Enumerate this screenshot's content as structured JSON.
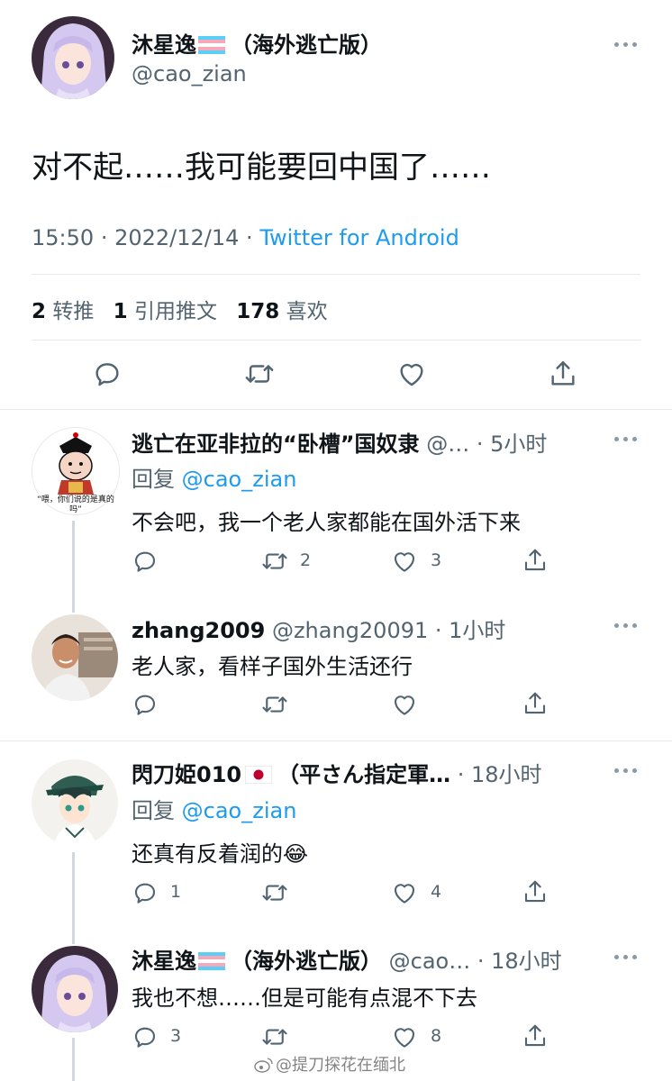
{
  "main_tweet": {
    "display_name": "沐星逸",
    "name_suffix": "（海外逃亡版）",
    "handle": "@cao_zian",
    "text": "对不起……我可能要回中国了……",
    "time": "15:50",
    "date": "2022/12/14",
    "source": "Twitter for Android",
    "retweets_count": "2",
    "retweets_label": "转推",
    "quotes_count": "1",
    "quotes_label": "引用推文",
    "likes_count": "178",
    "likes_label": "喜欢"
  },
  "replies": [
    {
      "display_name": "逃亡在亚非拉的“卧槽”国奴隶",
      "handle_trunc": "@…",
      "time": "5小时",
      "reply_prefix": "回复",
      "reply_to": "@cao_zian",
      "text": "不会吧，我一个老人家都能在国外活下来",
      "retweets": "2",
      "likes": "3",
      "avatar_caption": "“喂，你们说的是真的吗”"
    },
    {
      "display_name": "zhang2009",
      "handle": "@zhang20091",
      "time": "1小时",
      "text": "老人家，看样子国外生活还行"
    },
    {
      "display_name": "閃刀姫010",
      "name_suffix": "（平さん指定軍…",
      "time": "18小时",
      "reply_prefix": "回复",
      "reply_to": "@cao_zian",
      "text": "还真有反着润的",
      "emoji": "😂",
      "replies_count": "1",
      "likes": "4"
    },
    {
      "display_name": "沐星逸",
      "name_suffix": "（海外逃亡版）",
      "handle_trunc": "@cao…",
      "time": "18小时",
      "text": "我也不想……但是可能有点混不下去",
      "replies_count": "3",
      "likes": "8"
    }
  ],
  "watermark": "@提刀探花在缅北",
  "colors": {
    "accent": "#1d9bf0",
    "muted": "#536471",
    "divider": "#e7e9ea"
  }
}
